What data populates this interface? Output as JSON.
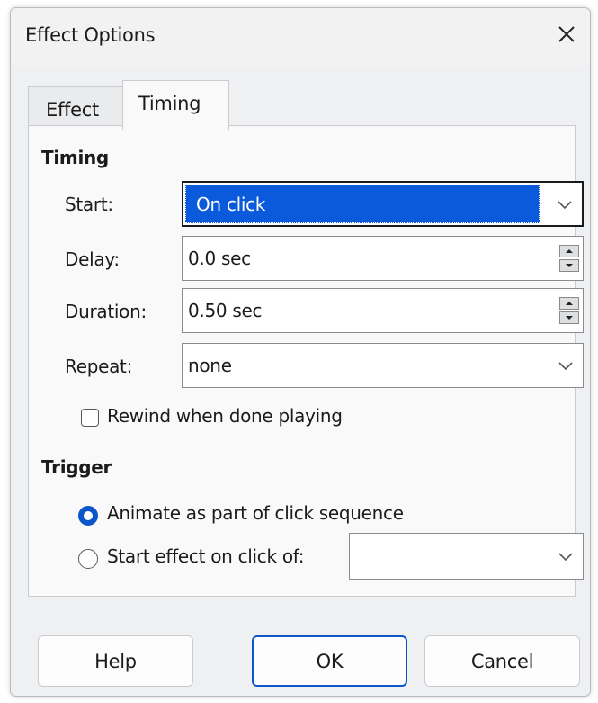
{
  "dialog": {
    "title": "Effect Options"
  },
  "tabs": [
    {
      "label": "Effect",
      "selected": false
    },
    {
      "label": "Timing",
      "selected": true
    }
  ],
  "timing": {
    "section_title": "Timing",
    "start": {
      "label": "Start:",
      "value": "On click"
    },
    "delay": {
      "label": "Delay:",
      "value": "0.0 sec"
    },
    "duration": {
      "label": "Duration:",
      "value": "0.50 sec"
    },
    "repeat": {
      "label": "Repeat:",
      "value": "none"
    },
    "rewind": {
      "label": "Rewind when done playing",
      "checked": false
    }
  },
  "trigger": {
    "section_title": "Trigger",
    "option_sequence": {
      "label": "Animate as part of click sequence",
      "selected": true
    },
    "option_click": {
      "label": "Start effect on click of:",
      "selected": false
    },
    "click_target_value": ""
  },
  "buttons": {
    "help": "Help",
    "ok": "OK",
    "cancel": "Cancel"
  },
  "colors": {
    "accent": "#0b57c8",
    "selection": "#0a5adb",
    "dialog_bg": "#eff0f2",
    "panel_bg": "#f9f9f9"
  },
  "icons": {
    "close": "close-icon",
    "dropdown": "chevron-down-icon",
    "spin_up": "spin-up-icon",
    "spin_down": "spin-down-icon"
  }
}
